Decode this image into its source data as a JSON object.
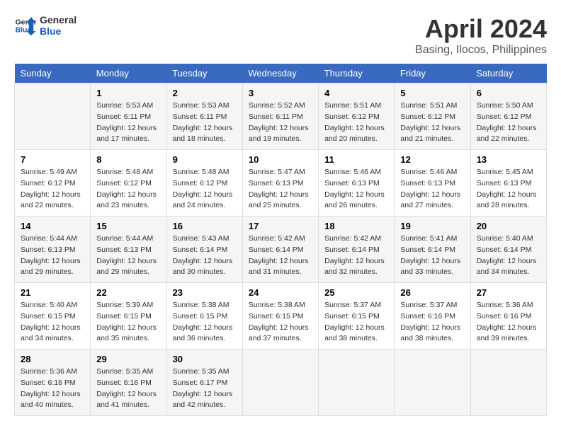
{
  "header": {
    "logo_line1": "General",
    "logo_line2": "Blue",
    "title": "April 2024",
    "subtitle": "Basing, Ilocos, Philippines"
  },
  "calendar": {
    "days_of_week": [
      "Sunday",
      "Monday",
      "Tuesday",
      "Wednesday",
      "Thursday",
      "Friday",
      "Saturday"
    ],
    "weeks": [
      [
        {
          "day": "",
          "info": ""
        },
        {
          "day": "1",
          "info": "Sunrise: 5:53 AM\nSunset: 6:11 PM\nDaylight: 12 hours\nand 17 minutes."
        },
        {
          "day": "2",
          "info": "Sunrise: 5:53 AM\nSunset: 6:11 PM\nDaylight: 12 hours\nand 18 minutes."
        },
        {
          "day": "3",
          "info": "Sunrise: 5:52 AM\nSunset: 6:11 PM\nDaylight: 12 hours\nand 19 minutes."
        },
        {
          "day": "4",
          "info": "Sunrise: 5:51 AM\nSunset: 6:12 PM\nDaylight: 12 hours\nand 20 minutes."
        },
        {
          "day": "5",
          "info": "Sunrise: 5:51 AM\nSunset: 6:12 PM\nDaylight: 12 hours\nand 21 minutes."
        },
        {
          "day": "6",
          "info": "Sunrise: 5:50 AM\nSunset: 6:12 PM\nDaylight: 12 hours\nand 22 minutes."
        }
      ],
      [
        {
          "day": "7",
          "info": "Sunrise: 5:49 AM\nSunset: 6:12 PM\nDaylight: 12 hours\nand 22 minutes."
        },
        {
          "day": "8",
          "info": "Sunrise: 5:48 AM\nSunset: 6:12 PM\nDaylight: 12 hours\nand 23 minutes."
        },
        {
          "day": "9",
          "info": "Sunrise: 5:48 AM\nSunset: 6:12 PM\nDaylight: 12 hours\nand 24 minutes."
        },
        {
          "day": "10",
          "info": "Sunrise: 5:47 AM\nSunset: 6:13 PM\nDaylight: 12 hours\nand 25 minutes."
        },
        {
          "day": "11",
          "info": "Sunrise: 5:46 AM\nSunset: 6:13 PM\nDaylight: 12 hours\nand 26 minutes."
        },
        {
          "day": "12",
          "info": "Sunrise: 5:46 AM\nSunset: 6:13 PM\nDaylight: 12 hours\nand 27 minutes."
        },
        {
          "day": "13",
          "info": "Sunrise: 5:45 AM\nSunset: 6:13 PM\nDaylight: 12 hours\nand 28 minutes."
        }
      ],
      [
        {
          "day": "14",
          "info": "Sunrise: 5:44 AM\nSunset: 6:13 PM\nDaylight: 12 hours\nand 29 minutes."
        },
        {
          "day": "15",
          "info": "Sunrise: 5:44 AM\nSunset: 6:13 PM\nDaylight: 12 hours\nand 29 minutes."
        },
        {
          "day": "16",
          "info": "Sunrise: 5:43 AM\nSunset: 6:14 PM\nDaylight: 12 hours\nand 30 minutes."
        },
        {
          "day": "17",
          "info": "Sunrise: 5:42 AM\nSunset: 6:14 PM\nDaylight: 12 hours\nand 31 minutes."
        },
        {
          "day": "18",
          "info": "Sunrise: 5:42 AM\nSunset: 6:14 PM\nDaylight: 12 hours\nand 32 minutes."
        },
        {
          "day": "19",
          "info": "Sunrise: 5:41 AM\nSunset: 6:14 PM\nDaylight: 12 hours\nand 33 minutes."
        },
        {
          "day": "20",
          "info": "Sunrise: 5:40 AM\nSunset: 6:14 PM\nDaylight: 12 hours\nand 34 minutes."
        }
      ],
      [
        {
          "day": "21",
          "info": "Sunrise: 5:40 AM\nSunset: 6:15 PM\nDaylight: 12 hours\nand 34 minutes."
        },
        {
          "day": "22",
          "info": "Sunrise: 5:39 AM\nSunset: 6:15 PM\nDaylight: 12 hours\nand 35 minutes."
        },
        {
          "day": "23",
          "info": "Sunrise: 5:38 AM\nSunset: 6:15 PM\nDaylight: 12 hours\nand 36 minutes."
        },
        {
          "day": "24",
          "info": "Sunrise: 5:38 AM\nSunset: 6:15 PM\nDaylight: 12 hours\nand 37 minutes."
        },
        {
          "day": "25",
          "info": "Sunrise: 5:37 AM\nSunset: 6:15 PM\nDaylight: 12 hours\nand 38 minutes."
        },
        {
          "day": "26",
          "info": "Sunrise: 5:37 AM\nSunset: 6:16 PM\nDaylight: 12 hours\nand 38 minutes."
        },
        {
          "day": "27",
          "info": "Sunrise: 5:36 AM\nSunset: 6:16 PM\nDaylight: 12 hours\nand 39 minutes."
        }
      ],
      [
        {
          "day": "28",
          "info": "Sunrise: 5:36 AM\nSunset: 6:16 PM\nDaylight: 12 hours\nand 40 minutes."
        },
        {
          "day": "29",
          "info": "Sunrise: 5:35 AM\nSunset: 6:16 PM\nDaylight: 12 hours\nand 41 minutes."
        },
        {
          "day": "30",
          "info": "Sunrise: 5:35 AM\nSunset: 6:17 PM\nDaylight: 12 hours\nand 42 minutes."
        },
        {
          "day": "",
          "info": ""
        },
        {
          "day": "",
          "info": ""
        },
        {
          "day": "",
          "info": ""
        },
        {
          "day": "",
          "info": ""
        }
      ]
    ]
  }
}
